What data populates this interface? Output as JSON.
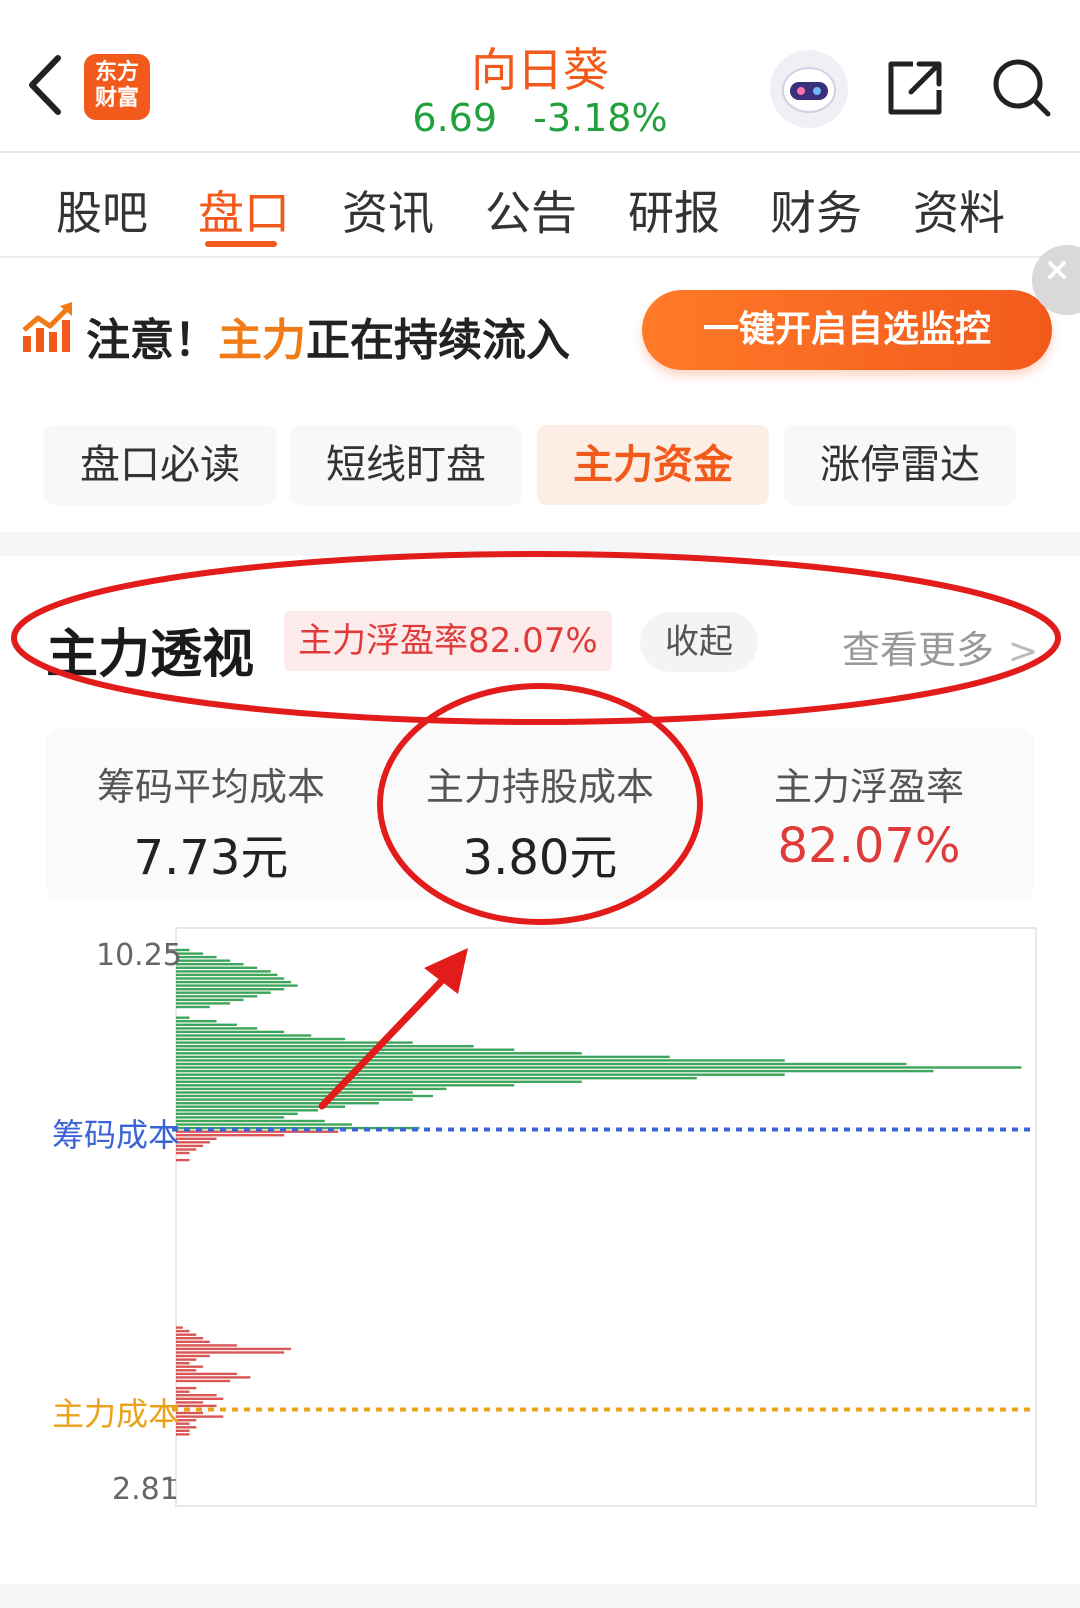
{
  "header": {
    "logo_line1": "东方",
    "logo_line2": "财富",
    "stock_name": "向日葵",
    "price": "6.69",
    "change": "-3.18%",
    "icons": [
      "back-icon",
      "robot-avatar",
      "share-icon",
      "search-icon"
    ]
  },
  "tabs": [
    {
      "label": "股吧"
    },
    {
      "label": "盘口",
      "active": true
    },
    {
      "label": "资讯"
    },
    {
      "label": "公告"
    },
    {
      "label": "研报"
    },
    {
      "label": "财务"
    },
    {
      "label": "资料"
    }
  ],
  "banner": {
    "prefix": "注意！",
    "highlight": "主力",
    "suffix": "正在持续流入",
    "button": "一键开启自选监控"
  },
  "subtabs": [
    {
      "label": "盘口必读"
    },
    {
      "label": "短线盯盘"
    },
    {
      "label": "主力资金",
      "active": true
    },
    {
      "label": "涨停雷达"
    }
  ],
  "section": {
    "title": "主力透视",
    "badge": "主力浮盈率82.07%",
    "collapse": "收起",
    "more": "查看更多"
  },
  "stats": [
    {
      "label": "筹码平均成本",
      "value": "7.73元"
    },
    {
      "label": "主力持股成本",
      "value": "3.80元"
    },
    {
      "label": "主力浮盈率",
      "value": "82.07%",
      "color": "#e03b3b"
    }
  ],
  "colors": {
    "brand": "#f25a1c",
    "up_green": "#22a03e",
    "profit_red": "#e03b3b",
    "chip_blue": "#3b64d6",
    "main_yellow": "#e9a21a",
    "annotation_red": "#e21b1b"
  },
  "chart_data": {
    "type": "bar",
    "orientation": "horizontal",
    "y_top_label": "10.25",
    "y_bottom_label": "2.81",
    "ylim": [
      2.81,
      10.25
    ],
    "chip_cost_label": "筹码成本",
    "chip_cost_value": 7.73,
    "main_cost_label": "主力成本",
    "main_cost_value": 3.8,
    "series": [
      {
        "color": "#3ea55a",
        "bars": [
          {
            "price": 10.25,
            "value": 2
          },
          {
            "price": 10.2,
            "value": 4
          },
          {
            "price": 10.15,
            "value": 6
          },
          {
            "price": 10.1,
            "value": 8
          },
          {
            "price": 10.05,
            "value": 10
          },
          {
            "price": 10.0,
            "value": 12
          },
          {
            "price": 9.95,
            "value": 14
          },
          {
            "price": 9.9,
            "value": 15
          },
          {
            "price": 9.85,
            "value": 16
          },
          {
            "price": 9.8,
            "value": 17
          },
          {
            "price": 9.75,
            "value": 18
          },
          {
            "price": 9.7,
            "value": 16
          },
          {
            "price": 9.65,
            "value": 14
          },
          {
            "price": 9.6,
            "value": 12
          },
          {
            "price": 9.55,
            "value": 10
          },
          {
            "price": 9.5,
            "value": 8
          },
          {
            "price": 9.45,
            "value": 5
          },
          {
            "price": 9.3,
            "value": 2
          },
          {
            "price": 9.25,
            "value": 6
          },
          {
            "price": 9.2,
            "value": 9
          },
          {
            "price": 9.15,
            "value": 12
          },
          {
            "price": 9.1,
            "value": 16
          },
          {
            "price": 9.05,
            "value": 20
          },
          {
            "price": 9.0,
            "value": 25
          },
          {
            "price": 8.95,
            "value": 35
          },
          {
            "price": 8.9,
            "value": 44
          },
          {
            "price": 8.85,
            "value": 50
          },
          {
            "price": 8.8,
            "value": 60
          },
          {
            "price": 8.75,
            "value": 73
          },
          {
            "price": 8.7,
            "value": 90
          },
          {
            "price": 8.65,
            "value": 108
          },
          {
            "price": 8.6,
            "value": 125
          },
          {
            "price": 8.55,
            "value": 112
          },
          {
            "price": 8.5,
            "value": 90
          },
          {
            "price": 8.45,
            "value": 77
          },
          {
            "price": 8.4,
            "value": 60
          },
          {
            "price": 8.35,
            "value": 50
          },
          {
            "price": 8.3,
            "value": 40
          },
          {
            "price": 8.25,
            "value": 35
          },
          {
            "price": 8.2,
            "value": 38
          },
          {
            "price": 8.15,
            "value": 35
          },
          {
            "price": 8.1,
            "value": 30
          },
          {
            "price": 8.05,
            "value": 25
          },
          {
            "price": 8.0,
            "value": 21
          },
          {
            "price": 7.95,
            "value": 18
          },
          {
            "price": 7.9,
            "value": 16
          },
          {
            "price": 7.85,
            "value": 22
          },
          {
            "price": 7.8,
            "value": 26
          },
          {
            "price": 7.75,
            "value": 36
          }
        ]
      },
      {
        "color": "#d95656",
        "bars": [
          {
            "price": 7.7,
            "value": 24
          },
          {
            "price": 7.65,
            "value": 16
          },
          {
            "price": 7.6,
            "value": 6
          },
          {
            "price": 7.55,
            "value": 5
          },
          {
            "price": 7.5,
            "value": 4
          },
          {
            "price": 7.45,
            "value": 3
          },
          {
            "price": 7.4,
            "value": 2
          },
          {
            "price": 7.3,
            "value": 2
          },
          {
            "price": 4.95,
            "value": 1
          },
          {
            "price": 4.9,
            "value": 2
          },
          {
            "price": 4.85,
            "value": 3
          },
          {
            "price": 4.8,
            "value": 4
          },
          {
            "price": 4.75,
            "value": 5
          },
          {
            "price": 4.7,
            "value": 9
          },
          {
            "price": 4.65,
            "value": 17
          },
          {
            "price": 4.6,
            "value": 16
          },
          {
            "price": 4.55,
            "value": 5
          },
          {
            "price": 4.5,
            "value": 3
          },
          {
            "price": 4.45,
            "value": 2
          },
          {
            "price": 4.4,
            "value": 4
          },
          {
            "price": 4.35,
            "value": 3
          },
          {
            "price": 4.3,
            "value": 9
          },
          {
            "price": 4.25,
            "value": 11
          },
          {
            "price": 4.2,
            "value": 8
          },
          {
            "price": 4.1,
            "value": 3
          },
          {
            "price": 4.05,
            "value": 2
          },
          {
            "price": 4.0,
            "value": 6
          },
          {
            "price": 3.95,
            "value": 7
          },
          {
            "price": 3.9,
            "value": 4
          },
          {
            "price": 3.85,
            "value": 6
          },
          {
            "price": 3.75,
            "value": 4
          },
          {
            "price": 3.7,
            "value": 7
          },
          {
            "price": 3.65,
            "value": 3
          },
          {
            "price": 3.6,
            "value": 2
          },
          {
            "price": 3.55,
            "value": 3
          },
          {
            "price": 3.5,
            "value": 2
          },
          {
            "price": 3.45,
            "value": 2
          }
        ]
      }
    ]
  }
}
